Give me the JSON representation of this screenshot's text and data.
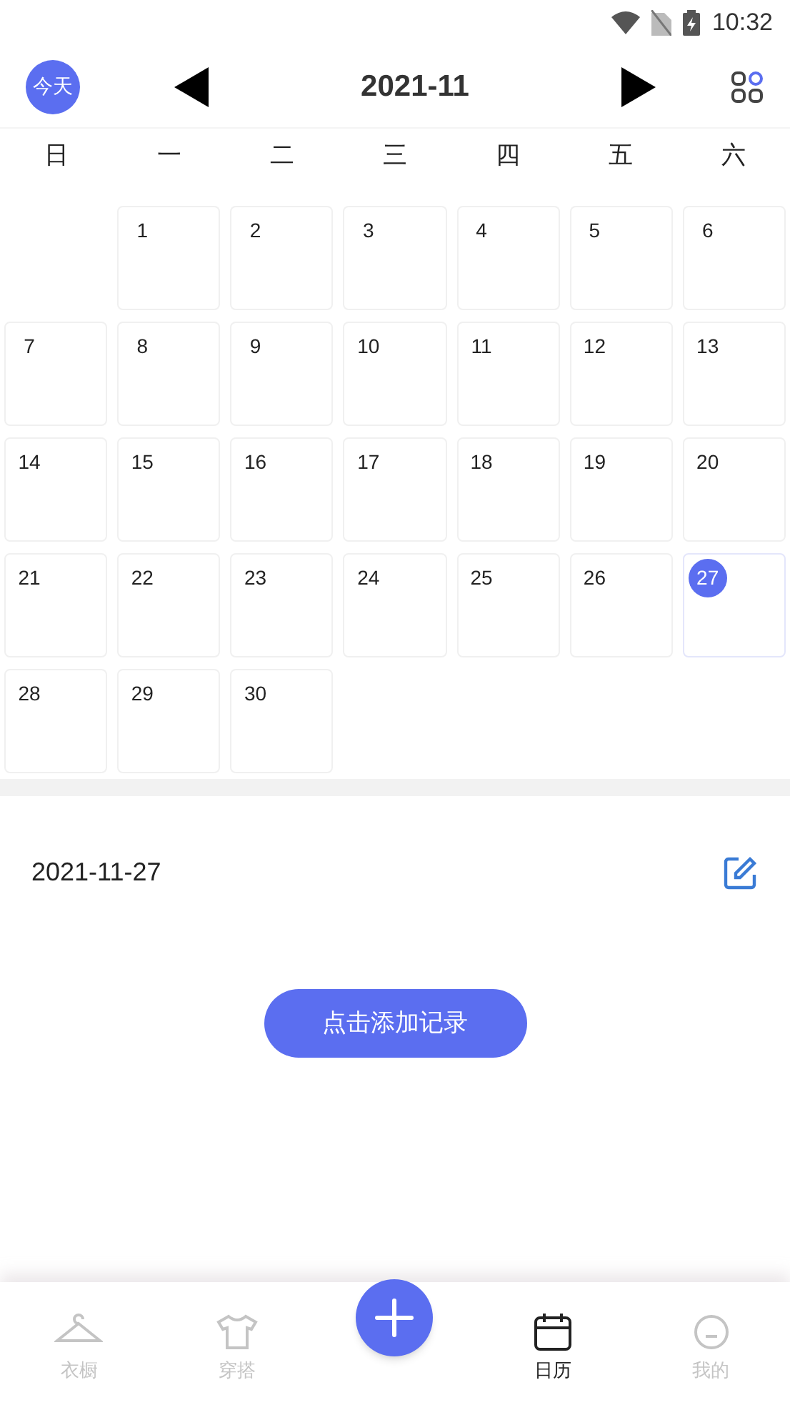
{
  "status_bar": {
    "time": "10:32"
  },
  "header": {
    "today_button": "今天",
    "month": "2021-11"
  },
  "weekdays": [
    "日",
    "一",
    "二",
    "三",
    "四",
    "五",
    "六"
  ],
  "days": [
    {
      "kind": "blank"
    },
    {
      "label": "1",
      "kind": "day",
      "selected": false
    },
    {
      "label": "2",
      "kind": "day",
      "selected": false
    },
    {
      "label": "3",
      "kind": "day",
      "selected": false
    },
    {
      "label": "4",
      "kind": "day",
      "selected": false
    },
    {
      "label": "5",
      "kind": "day",
      "selected": false
    },
    {
      "label": "6",
      "kind": "day",
      "selected": false
    },
    {
      "label": "7",
      "kind": "day",
      "selected": false
    },
    {
      "label": "8",
      "kind": "day",
      "selected": false
    },
    {
      "label": "9",
      "kind": "day",
      "selected": false
    },
    {
      "label": "10",
      "kind": "day",
      "selected": false
    },
    {
      "label": "11",
      "kind": "day",
      "selected": false
    },
    {
      "label": "12",
      "kind": "day",
      "selected": false
    },
    {
      "label": "13",
      "kind": "day",
      "selected": false
    },
    {
      "label": "14",
      "kind": "day",
      "selected": false
    },
    {
      "label": "15",
      "kind": "day",
      "selected": false
    },
    {
      "label": "16",
      "kind": "day",
      "selected": false
    },
    {
      "label": "17",
      "kind": "day",
      "selected": false
    },
    {
      "label": "18",
      "kind": "day",
      "selected": false
    },
    {
      "label": "19",
      "kind": "day",
      "selected": false
    },
    {
      "label": "20",
      "kind": "day",
      "selected": false
    },
    {
      "label": "21",
      "kind": "day",
      "selected": false
    },
    {
      "label": "22",
      "kind": "day",
      "selected": false
    },
    {
      "label": "23",
      "kind": "day",
      "selected": false
    },
    {
      "label": "24",
      "kind": "day",
      "selected": false
    },
    {
      "label": "25",
      "kind": "day",
      "selected": false
    },
    {
      "label": "26",
      "kind": "day",
      "selected": false
    },
    {
      "label": "27",
      "kind": "day",
      "selected": true
    },
    {
      "label": "28",
      "kind": "day",
      "selected": false
    },
    {
      "label": "29",
      "kind": "day",
      "selected": false
    },
    {
      "label": "30",
      "kind": "day",
      "selected": false
    }
  ],
  "record": {
    "date": "2021-11-27",
    "add_button": "点击添加记录"
  },
  "nav": [
    {
      "label": "衣橱",
      "kind": "hanger",
      "selected": false
    },
    {
      "label": "穿搭",
      "kind": "shirt",
      "selected": false
    },
    {
      "kind": "add",
      "selected": false
    },
    {
      "label": "日历",
      "kind": "calendar",
      "selected": true
    },
    {
      "label": "我的",
      "kind": "face",
      "selected": false
    }
  ]
}
